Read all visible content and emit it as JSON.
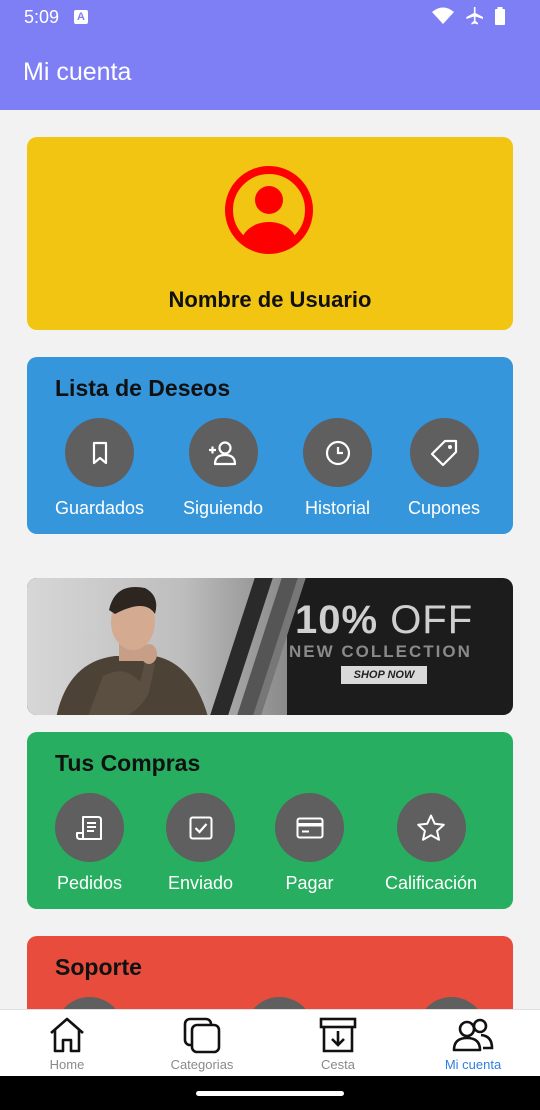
{
  "status": {
    "time": "5:09",
    "notification_badge": "A"
  },
  "appbar": {
    "title": "Mi cuenta"
  },
  "profile": {
    "username": "Nombre de Usuario",
    "avatar_icon": "user-circle-icon",
    "avatar_color": "#ff0000"
  },
  "wishlist": {
    "title": "Lista de Deseos",
    "items": [
      {
        "label": "Guardados",
        "icon": "bookmark-icon"
      },
      {
        "label": "Siguiendo",
        "icon": "add-user-icon"
      },
      {
        "label": "Historial",
        "icon": "clock-icon"
      },
      {
        "label": "Cupones",
        "icon": "tag-icon"
      }
    ]
  },
  "banner": {
    "offer_bold": "10%",
    "offer_thin": "OFF",
    "collection": "NEW COLLECTION",
    "shop": "SHOP NOW"
  },
  "purchases": {
    "title": "Tus Compras",
    "items": [
      {
        "label": "Pedidos",
        "icon": "receipt-icon"
      },
      {
        "label": "Enviado",
        "icon": "checkbox-icon"
      },
      {
        "label": "Pagar",
        "icon": "credit-card-icon"
      },
      {
        "label": "Calificación",
        "icon": "star-icon"
      }
    ]
  },
  "support": {
    "title": "Soporte"
  },
  "bottom_nav": {
    "items": [
      {
        "label": "Home",
        "icon": "home-icon"
      },
      {
        "label": "Categorias",
        "icon": "categories-icon"
      },
      {
        "label": "Cesta",
        "icon": "basket-icon"
      },
      {
        "label": "Mi cuenta",
        "icon": "users-icon",
        "active": true
      }
    ]
  },
  "colors": {
    "accent": "#7f7ff5",
    "active_nav": "#2f7fe0",
    "profile_card": "#f1c512",
    "wishlist_card": "#3596dc",
    "purchases_card": "#27ae60",
    "support_card": "#e84c3d"
  }
}
